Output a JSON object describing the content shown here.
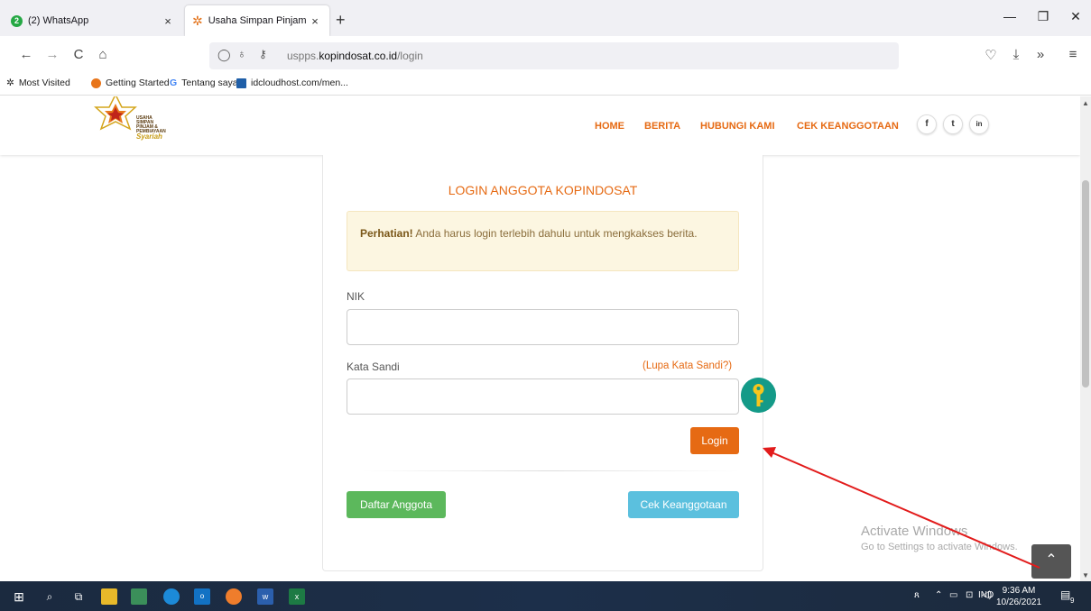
{
  "browser": {
    "tabs": [
      {
        "title": "(2) WhatsApp",
        "badge": "2",
        "close": "×"
      },
      {
        "title": "Usaha Simpan Pinjam Syariah -",
        "close": "×"
      }
    ],
    "new_tab": "+",
    "window_controls": {
      "minimize": "—",
      "maximize": "❐",
      "close": "✕"
    },
    "nav": {
      "back": "←",
      "forward": "→",
      "reload": "C",
      "home": "⌂"
    },
    "url": {
      "prefix": "uspps.",
      "domain": "kopindosat.co.id",
      "path": "/login"
    },
    "bookmarks": [
      "Most Visited",
      "Getting Started",
      "Tentang saya",
      "idcloudhost.com/men..."
    ]
  },
  "site": {
    "logo": {
      "line1": "USAHA",
      "line2": "SIMPAN",
      "line3": "PINJAM &",
      "line4": "PEMBIAYAAN",
      "line5": "Syariah"
    },
    "nav": [
      "HOME",
      "BERITA",
      "HUBUNGI KAMI",
      "CEK KEANGGOTAAN"
    ],
    "social": [
      "f",
      "t",
      "in"
    ]
  },
  "login": {
    "title": "LOGIN ANGGOTA KOPINDOSAT",
    "alert_strong": "Perhatian!",
    "alert_text": " Anda harus login terlebih dahulu untuk mengkakses berita.",
    "nik_label": "NIK",
    "password_label": "Kata Sandi",
    "forgot": "(Lupa Kata Sandi?)",
    "login_button": "Login",
    "register_button": "Daftar Anggota",
    "check_button": "Cek Keanggotaan"
  },
  "watermark": {
    "line1": "Activate Windows",
    "line2": "Go to Settings to activate Windows."
  },
  "taskbar": {
    "language": "IND",
    "time": "9:36 AM",
    "date": "10/26/2021",
    "notifications": "9"
  },
  "colors": {
    "accent": "#e66a13",
    "success": "#5cb85c",
    "info": "#5bc0de",
    "alert_bg": "#fcf6e1"
  }
}
